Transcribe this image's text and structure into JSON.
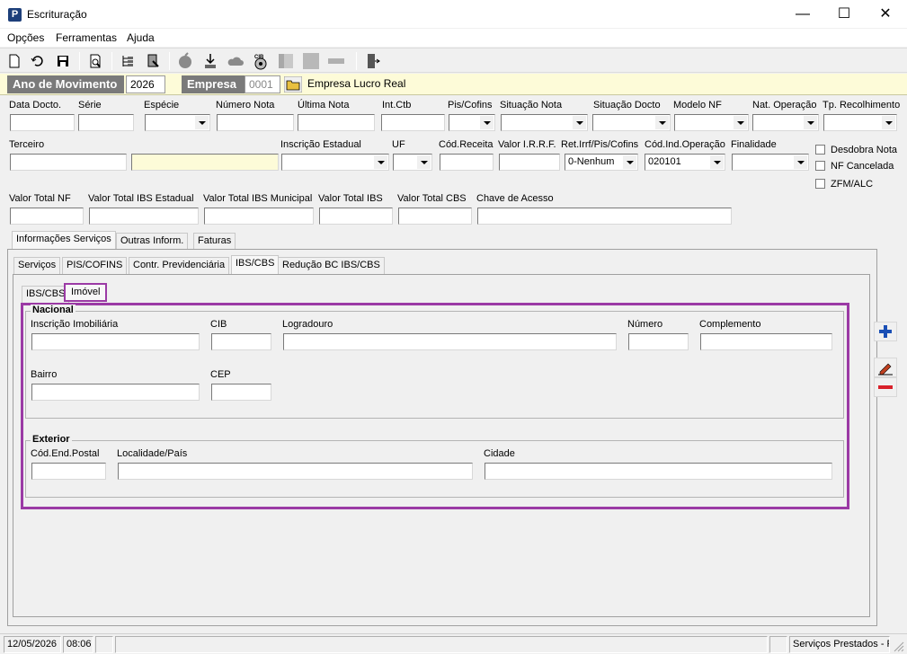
{
  "window": {
    "title": "Escrituração",
    "app_icon": "P",
    "minimize": "—",
    "maximize": "☐",
    "close": "✕"
  },
  "menu": [
    "Opções",
    "Ferramentas",
    "Ajuda"
  ],
  "toolbar_icons": [
    "new-icon",
    "undo-icon",
    "save-icon",
    "preview-icon",
    "tree-icon",
    "export-icon",
    "apple-icon",
    "download-icon",
    "cloud-icon",
    "cib-icon",
    "columns-icon",
    "blank-icon",
    "minus-icon",
    "exit-icon"
  ],
  "header": {
    "ano_label": "Ano de Movimento",
    "ano_value": "2026",
    "empresa_label": "Empresa",
    "empresa_code": "0001",
    "empresa_name": "Empresa Lucro Real"
  },
  "row1": {
    "labels": [
      "Data Docto.",
      "Série",
      "Espécie",
      "Número Nota",
      "Última Nota",
      "Int.Ctb",
      "Pis/Cofins",
      "Situação Nota",
      "Situação Docto",
      "Modelo NF",
      "Nat. Operação",
      "Tp. Recolhimento"
    ]
  },
  "row2": {
    "labels": [
      "Terceiro",
      "Inscrição Estadual",
      "UF",
      "Cód.Receita",
      "Valor I.R.R.F.",
      "Ret.Irrf/Pis/Cofins",
      "Cód.Ind.Operação",
      "Finalidade"
    ],
    "ret_value": "0-Nenhum",
    "cod_ind_value": "020101"
  },
  "checkboxes": [
    "Desdobra Nota",
    "NF Cancelada",
    "ZFM/ALC"
  ],
  "row3": {
    "labels": [
      "Valor Total NF",
      "Valor Total IBS Estadual",
      "Valor Total IBS Municipal",
      "Valor Total IBS",
      "Valor Total CBS",
      "Chave de Acesso"
    ]
  },
  "tabs_main": [
    "Informações Serviços",
    "Outras Inform.",
    "Faturas"
  ],
  "tabs_sub": [
    "Serviços",
    "PIS/COFINS",
    "Contr. Previdenciária",
    "IBS/CBS",
    "Redução BC IBS/CBS"
  ],
  "tabs_inner": [
    "IBS/CBS",
    "Imóvel"
  ],
  "nacional": {
    "title": "Nacional",
    "labels": [
      "Inscrição Imobiliária",
      "CIB",
      "Logradouro",
      "Número",
      "Complemento",
      "Bairro",
      "CEP"
    ]
  },
  "exterior": {
    "title": "Exterior",
    "labels": [
      "Cód.End.Postal",
      "Localidade/País",
      "Cidade"
    ]
  },
  "side_buttons": [
    "plus-icon",
    "edit-icon",
    "minus-icon"
  ],
  "status": {
    "date": "12/05/2026",
    "time": "08:06",
    "module": "Serviços Prestados - P"
  },
  "colors": {
    "highlight": "#9b3aa5",
    "header_bg": "#fdfbd8",
    "header_label": "#7a7a7a",
    "plus": "#1a4fb5",
    "minus": "#d8202a"
  }
}
